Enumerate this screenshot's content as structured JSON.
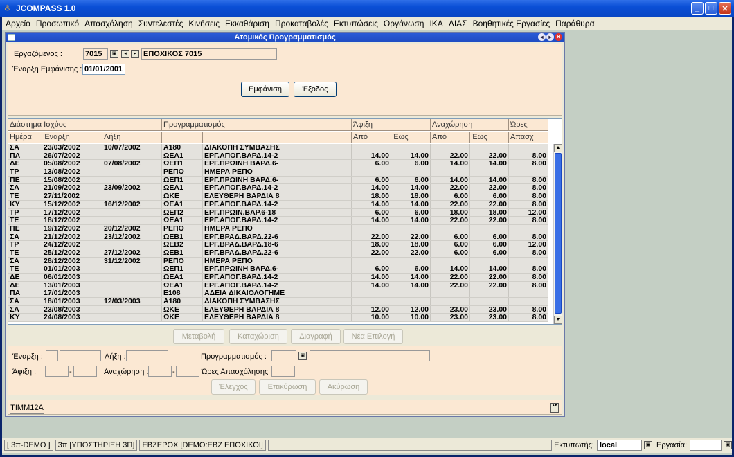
{
  "app_title": "JCOMPASS 1.0",
  "menu": [
    "Αρχείο",
    "Προσωπικό",
    "Απασχόληση",
    "Συντελεστές",
    "Κινήσεις",
    "Εκκαθάριση",
    "Προκαταβολές",
    "Εκτυπώσεις",
    "Οργάνωση",
    "ΙΚΑ",
    "ΔΙΑΣ",
    "Βοηθητικές Εργασίες",
    "Παράθυρα"
  ],
  "window_title": "Ατομικός Προγραμματισμός",
  "form": {
    "employee_label": "Εργαζόμενος :",
    "employee_code": "7015",
    "employee_name": "ΕΠΟΧΙΚΟΣ 7015",
    "start_label": "Έναρξη Εμφάνισης :",
    "start_value": "01/01/2001",
    "show_button": "Εμφάνιση",
    "exit_button": "Έξοδος"
  },
  "grid": {
    "groups": [
      "Διάστημα Ισχύος",
      "Προγραμματισμός",
      "Άφιξη",
      "Αναχώρηση",
      "Ώρες"
    ],
    "columns": [
      "Ημέρα",
      "Έναρξη",
      "Λήξη",
      "",
      "",
      "Από",
      "Έως",
      "Από",
      "Έως",
      "Απασχ"
    ],
    "rows": [
      [
        "ΣΑ",
        "23/03/2002",
        "10/07/2002",
        "Α180",
        "ΔΙΑΚΟΠΗ ΣΥΜΒΑΣΗΣ",
        "",
        "",
        "",
        "",
        ""
      ],
      [
        "ΠΑ",
        "26/07/2002",
        "",
        "ΩΕΑ1",
        "ΕΡΓ.ΑΠΟΓ.ΒΑΡΔ.14-2",
        "14.00",
        "14.00",
        "22.00",
        "22.00",
        "8.00"
      ],
      [
        "ΔΕ",
        "05/08/2002",
        "07/08/2002",
        "ΩΕΠ1",
        "ΕΡΓ.ΠΡΩΙΝΗ ΒΑΡΔ.6-",
        "6.00",
        "6.00",
        "14.00",
        "14.00",
        "8.00"
      ],
      [
        "ΤΡ",
        "13/08/2002",
        "",
        "ΡΕΠΟ",
        "ΗΜΕΡΑ ΡΕΠΟ",
        "",
        "",
        "",
        "",
        ""
      ],
      [
        "ΠΕ",
        "15/08/2002",
        "",
        "ΩΕΠ1",
        "ΕΡΓ.ΠΡΩΙΝΗ ΒΑΡΔ.6-",
        "6.00",
        "6.00",
        "14.00",
        "14.00",
        "8.00"
      ],
      [
        "ΣΑ",
        "21/09/2002",
        "23/09/2002",
        "ΩΕΑ1",
        "ΕΡΓ.ΑΠΟΓ.ΒΑΡΔ.14-2",
        "14.00",
        "14.00",
        "22.00",
        "22.00",
        "8.00"
      ],
      [
        "ΤΕ",
        "27/11/2002",
        "",
        "ΩΚΕ",
        "ΕΛΕΥΘΕΡΗ ΒΑΡΔΙΑ 8",
        "18.00",
        "18.00",
        "6.00",
        "6.00",
        "8.00"
      ],
      [
        "ΚΥ",
        "15/12/2002",
        "16/12/2002",
        "ΩΕΑ1",
        "ΕΡΓ.ΑΠΟΓ.ΒΑΡΔ.14-2",
        "14.00",
        "14.00",
        "22.00",
        "22.00",
        "8.00"
      ],
      [
        "ΤΡ",
        "17/12/2002",
        "",
        "ΩΕΠ2",
        "ΕΡΓ.ΠΡΩΙΝ.ΒΑΡ.6-18",
        "6.00",
        "6.00",
        "18.00",
        "18.00",
        "12.00"
      ],
      [
        "ΤΕ",
        "18/12/2002",
        "",
        "ΩΕΑ1",
        "ΕΡΓ.ΑΠΟΓ.ΒΑΡΔ.14-2",
        "14.00",
        "14.00",
        "22.00",
        "22.00",
        "8.00"
      ],
      [
        "ΠΕ",
        "19/12/2002",
        "20/12/2002",
        "ΡΕΠΟ",
        "ΗΜΕΡΑ ΡΕΠΟ",
        "",
        "",
        "",
        "",
        ""
      ],
      [
        "ΣΑ",
        "21/12/2002",
        "23/12/2002",
        "ΩΕΒ1",
        "ΕΡΓ.ΒΡΑΔ.ΒΑΡΔ.22-6",
        "22.00",
        "22.00",
        "6.00",
        "6.00",
        "8.00"
      ],
      [
        "ΤΡ",
        "24/12/2002",
        "",
        "ΩΕΒ2",
        "ΕΡΓ.ΒΡΑΔ.ΒΑΡΔ.18-6",
        "18.00",
        "18.00",
        "6.00",
        "6.00",
        "12.00"
      ],
      [
        "ΤΕ",
        "25/12/2002",
        "27/12/2002",
        "ΩΕΒ1",
        "ΕΡΓ.ΒΡΑΔ.ΒΑΡΔ.22-6",
        "22.00",
        "22.00",
        "6.00",
        "6.00",
        "8.00"
      ],
      [
        "ΣΑ",
        "28/12/2002",
        "31/12/2002",
        "ΡΕΠΟ",
        "ΗΜΕΡΑ ΡΕΠΟ",
        "",
        "",
        "",
        "",
        ""
      ],
      [
        "ΤΕ",
        "01/01/2003",
        "",
        "ΩΕΠ1",
        "ΕΡΓ.ΠΡΩΙΝΗ ΒΑΡΔ.6-",
        "6.00",
        "6.00",
        "14.00",
        "14.00",
        "8.00"
      ],
      [
        "ΔΕ",
        "06/01/2003",
        "",
        "ΩΕΑ1",
        "ΕΡΓ.ΑΠΟΓ.ΒΑΡΔ.14-2",
        "14.00",
        "14.00",
        "22.00",
        "22.00",
        "8.00"
      ],
      [
        "ΔΕ",
        "13/01/2003",
        "",
        "ΩΕΑ1",
        "ΕΡΓ.ΑΠΟΓ.ΒΑΡΔ.14-2",
        "14.00",
        "14.00",
        "22.00",
        "22.00",
        "8.00"
      ],
      [
        "ΠΑ",
        "17/01/2003",
        "",
        "Ε108",
        "ΑΔΕΙΑ ΔΙΚΑΙΟΛΟΓΗΜΕ",
        "",
        "",
        "",
        "",
        ""
      ],
      [
        "ΣΑ",
        "18/01/2003",
        "12/03/2003",
        "Α180",
        "ΔΙΑΚΟΠΗ ΣΥΜΒΑΣΗΣ",
        "",
        "",
        "",
        "",
        ""
      ],
      [
        "ΣΑ",
        "23/08/2003",
        "",
        "ΩΚΕ",
        "ΕΛΕΥΘΕΡΗ ΒΑΡΔΙΑ 8",
        "12.00",
        "12.00",
        "23.00",
        "23.00",
        "8.00"
      ],
      [
        "ΚΥ",
        "24/08/2003",
        "",
        "ΩΚΕ",
        "ΕΛΕΥΘΕΡΗ ΒΑΡΔΙΑ 8",
        "10.00",
        "10.00",
        "23.00",
        "23.00",
        "8.00"
      ]
    ]
  },
  "actions": {
    "modify": "Μεταβολή",
    "insert": "Καταχώριση",
    "delete": "Διαγραφή",
    "new": "Νέα Επιλογή"
  },
  "edit": {
    "start": "Έναρξη :",
    "end": "Λήξη :",
    "schedule": "Προγραμματισμός :",
    "arrival": "Άφιξη :",
    "departure": "Αναχώρηση :",
    "hours": "Ώρες Απασχόλησης :",
    "dash": "-",
    "check": "Έλεγχος",
    "confirm": "Επικύρωση",
    "cancel": "Ακύρωση"
  },
  "tab": "TIMM12A",
  "status": {
    "s1": "[ 3π-DEMO ]",
    "s2": "3π [ΥΠΟΣΤΗΡΙΞΗ 3Π]",
    "s3": "ΕΒΖΕΡΟΧ [DEMO:ΕΒΖ ΕΠΟΧΙΚΟΙ]",
    "printer_label": "Εκτυπωτής:",
    "printer": "local",
    "work_label": "Εργασία:"
  }
}
